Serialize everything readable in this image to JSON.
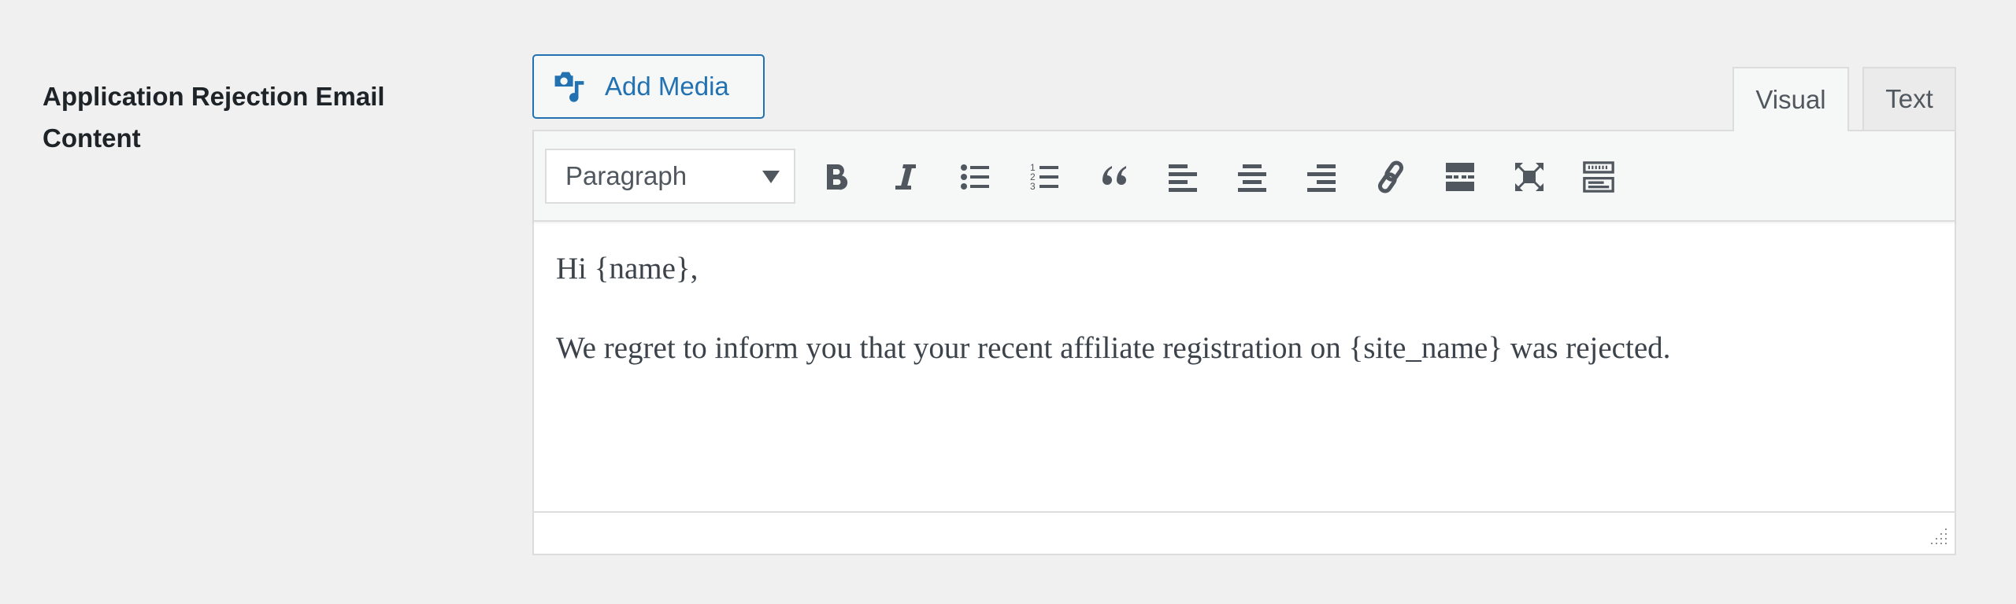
{
  "field": {
    "label": "Application Rejection Email Content"
  },
  "media": {
    "add_media_label": "Add Media",
    "icon": "camera-music-icon"
  },
  "tabs": [
    {
      "label": "Visual",
      "active": true
    },
    {
      "label": "Text",
      "active": false
    }
  ],
  "toolbar": {
    "format_select": {
      "selected": "Paragraph"
    },
    "buttons": [
      "bold",
      "italic",
      "bulleted-list",
      "numbered-list",
      "blockquote",
      "align-left",
      "align-center",
      "align-right",
      "insert-link",
      "read-more",
      "fullscreen",
      "toolbar-toggle"
    ]
  },
  "content": {
    "paragraphs": [
      "Hi {name},",
      "We regret to inform you that your recent affiliate registration on {site_name} was rejected."
    ]
  },
  "colors": {
    "accent": "#2271b1",
    "icon": "#50575e",
    "background": "#f0f0f1"
  }
}
